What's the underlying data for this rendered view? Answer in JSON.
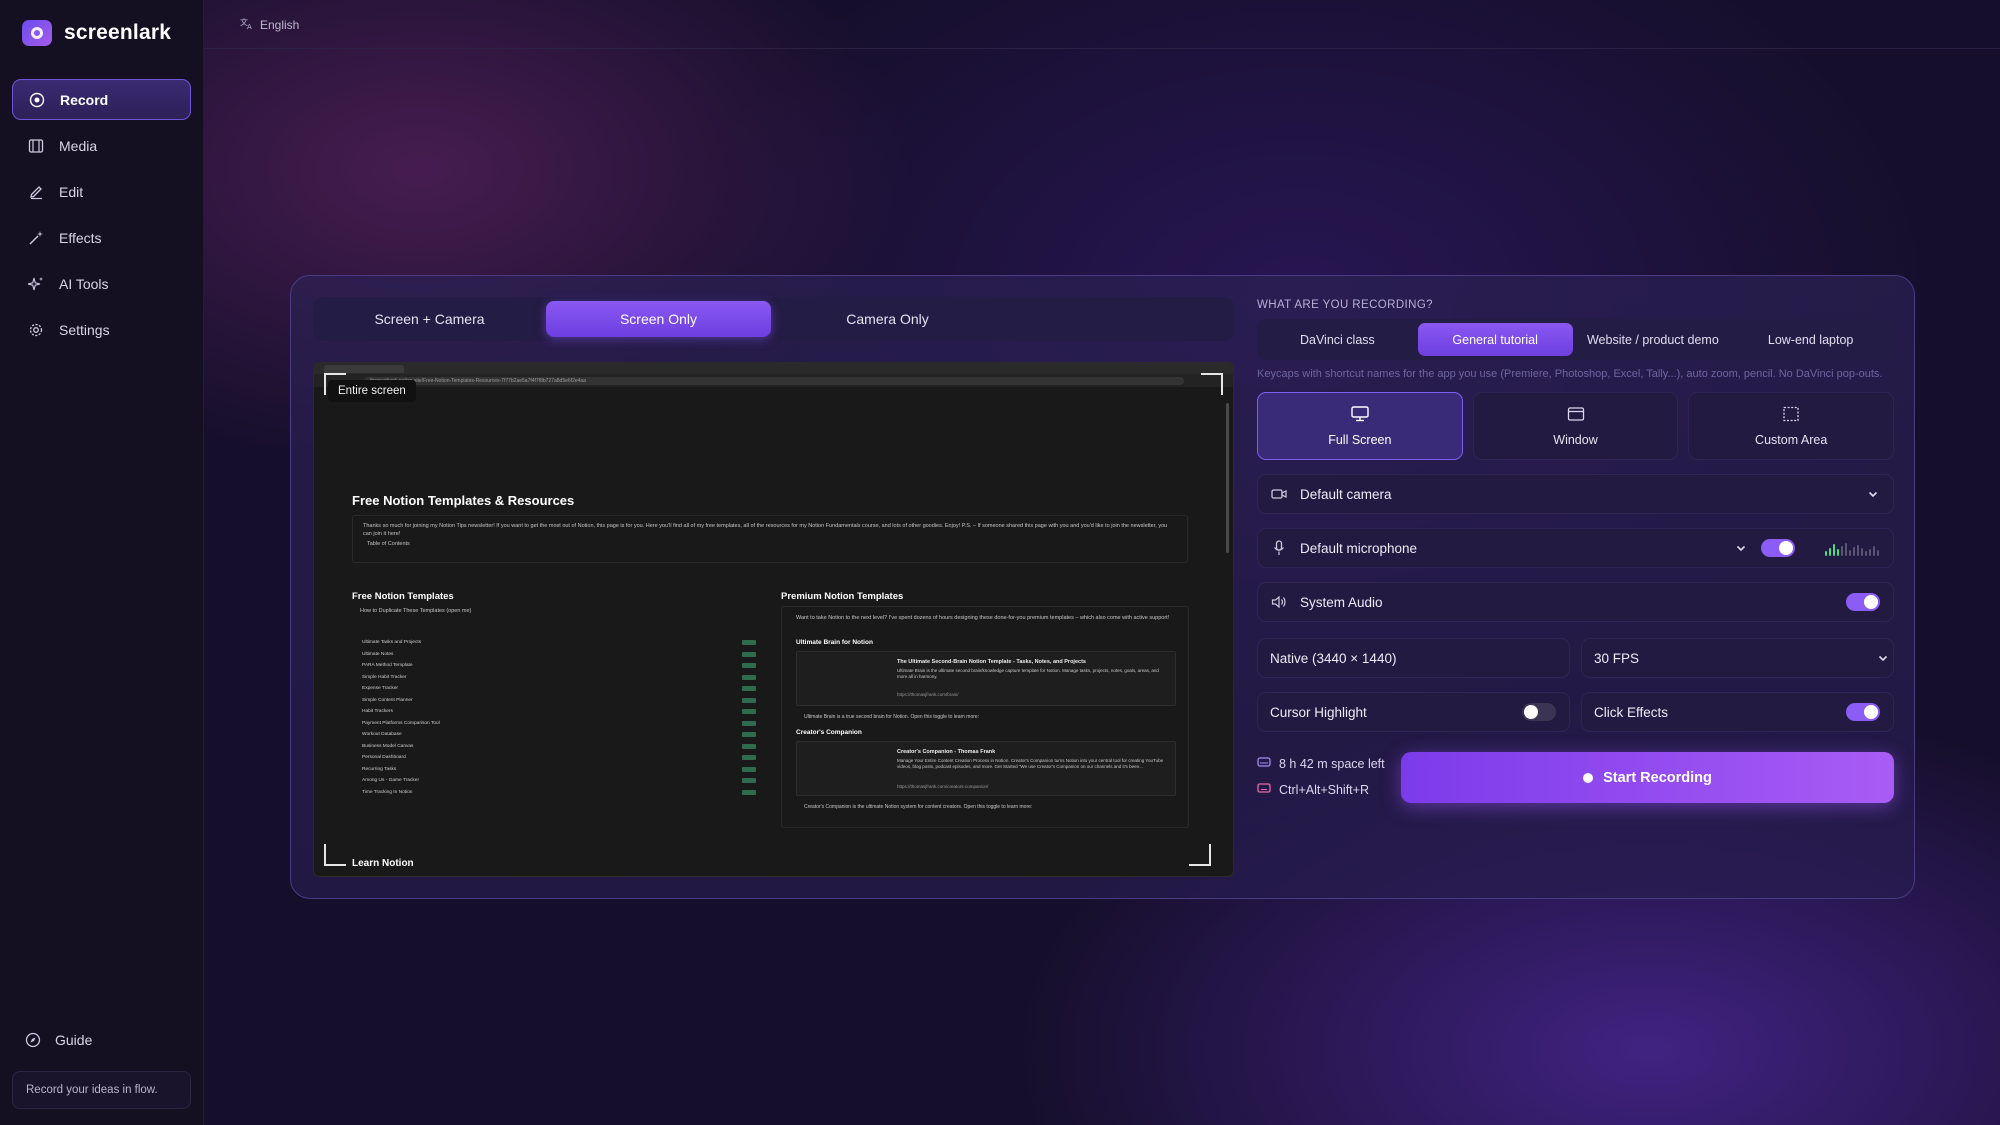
{
  "app": {
    "name": "screenlark"
  },
  "topbar": {
    "language": "English"
  },
  "sidebar": {
    "items": [
      {
        "label": "Record",
        "icon": "record-icon",
        "active": true
      },
      {
        "label": "Media",
        "icon": "media-icon"
      },
      {
        "label": "Edit",
        "icon": "pencil-icon"
      },
      {
        "label": "Effects",
        "icon": "sparkle-wand-icon"
      },
      {
        "label": "AI Tools",
        "icon": "ai-sparkle-icon"
      },
      {
        "label": "Settings",
        "icon": "gear-icon"
      }
    ],
    "guide": "Guide",
    "tagline": "Record your ideas in flow."
  },
  "mode_tabs": [
    "Screen + Camera",
    "Screen Only",
    "Camera Only"
  ],
  "mode_selected": "Screen Only",
  "preview": {
    "badge": "Entire screen",
    "url": "thomasfrank.notion.site/Free-Notion-Templates-Resources-7f77b2ae5a7f4f7f8b727a8d5e6f2e4aa",
    "page_title": "Free Notion Templates & Resources",
    "intro": "Thanks so much for joining my Notion Tips newsletter! If you want to get the most out of Notion, this page is for you. Here you'll find all of my free templates, all of the resources for my Notion Fundamentals course, and lots of other goodies. Enjoy! P.S. – If someone shared this page with you and you'd like to join the newsletter, you can join it here!",
    "toc": "Table of Contents",
    "free_heading": "Free Notion Templates",
    "free_sub": "How to Duplicate These Templates (open me)",
    "templates": [
      "Ultimate Tasks and Projects",
      "Ultimate Notes",
      "PARA Method Template",
      "Simple Habit Tracker",
      "Expense Tracker",
      "Simple Content Planner",
      "Habit Trackers",
      "Payment Platforms Comparison Tool",
      "Workout Database",
      "Business Model Canvas",
      "Personal Dashboard",
      "Recurring Tasks",
      "Among Us - Game Tracker",
      "Time Tracking In Notion"
    ],
    "premium_heading": "Premium Notion Templates",
    "premium_intro": "Want to take Notion to the next level? I've spent dozens of hours designing these done-for-you premium templates – which also come with active support!",
    "ub_heading": "Ultimate Brain for Notion",
    "ub_card_title": "The Ultimate Second-Brain Notion Template - Tasks, Notes, and Projects",
    "ub_card_desc": "Ultimate Brain is the ultimate second brain/knowledge capture template for Notion. Manage tasks, projects, notes, goals, areas, and more all in harmony.",
    "ub_card_url": "https://thomasjfrank.com/brain/",
    "ub_toggle": "Ultimate Brain is a true second brain for Notion. Open this toggle to learn more:",
    "cc_heading": "Creator's Companion",
    "cc_card_title": "Creator's Companion - Thomas Frank",
    "cc_card_desc": "Manage Your Entire Content Creation Process in Notion. Creator's Companion turns Notion into your central tool for creating YouTube videos, blog posts, podcast episodes, and more. Get Started \"We use Creator's Companion on our channels and it's been...",
    "cc_card_url": "https://thomasjfrank.com/creators-companion/",
    "cc_toggle": "Creator's Companion is the ultimate Notion system for content creators. Open this toggle to learn more:",
    "learn": "Learn Notion"
  },
  "recording": {
    "question": "WHAT ARE YOU RECORDING?",
    "presets": [
      "DaVinci class",
      "General tutorial",
      "Website / product demo",
      "Low-end laptop"
    ],
    "preset_selected": "General tutorial",
    "preset_hint": "Keycaps with shortcut names for the app you use (Premiere, Photoshop, Excel, Tally...), auto zoom, pencil. No DaVinci pop-outs.",
    "sources": [
      {
        "label": "Full Screen",
        "icon": "monitor-icon",
        "active": true
      },
      {
        "label": "Window",
        "icon": "window-icon"
      },
      {
        "label": "Custom Area",
        "icon": "dashed-area-icon"
      }
    ],
    "camera": "Default camera",
    "microphone": "Default microphone",
    "microphone_enabled": true,
    "system_audio": "System Audio",
    "system_audio_enabled": true,
    "resolution": "Native (3440 × 1440)",
    "fps": "30 FPS",
    "cursor_highlight": "Cursor Highlight",
    "cursor_highlight_enabled": false,
    "click_effects": "Click Effects",
    "click_effects_enabled": true,
    "space_left": "8 h 42 m space left",
    "shortcut": "Ctrl+Alt+Shift+R",
    "start_label": "Start Recording"
  },
  "colors": {
    "accent": "#8b5cf6",
    "accent_dark": "#6d3fe0",
    "background": "#160f2c",
    "meter_active": "#4ade80"
  }
}
